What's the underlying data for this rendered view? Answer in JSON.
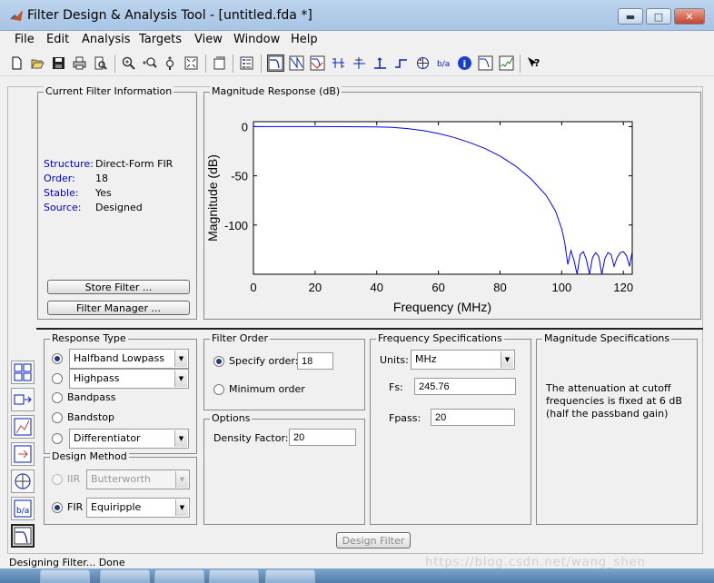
{
  "window": {
    "title": "Filter Design & Analysis Tool -  [untitled.fda *]"
  },
  "menu": [
    "File",
    "Edit",
    "Analysis",
    "Targets",
    "View",
    "Window",
    "Help"
  ],
  "toolbar": {
    "icons": [
      "new-file-icon",
      "open-folder-icon",
      "save-icon",
      "print-icon",
      "print-preview-icon",
      "zoom-in-icon",
      "zoom-x-icon",
      "zoom-y-icon",
      "full-view-icon",
      "new-figure-icon",
      "legend-icon",
      "magnitude-response-icon",
      "phase-response-icon",
      "magnitude-phase-icon",
      "group-delay-icon",
      "phase-delay-icon",
      "impulse-response-icon",
      "step-response-icon",
      "pole-zero-icon",
      "filter-coefficients-icon",
      "filter-info-icon",
      "magnitude-estimate-icon",
      "round-off-noise-icon",
      "whats-this-icon"
    ]
  },
  "current_filter_info": {
    "title": "Current Filter Information",
    "rows": [
      {
        "label": "Structure:",
        "value": "Direct-Form FIR"
      },
      {
        "label": "Order:",
        "value": "18"
      },
      {
        "label": "Stable:",
        "value": "Yes"
      },
      {
        "label": "Source:",
        "value": "Designed"
      }
    ],
    "store_filter_label": "Store Filter ...",
    "filter_manager_label": "Filter Manager ..."
  },
  "magnitude_response": {
    "title": "Magnitude Response (dB)"
  },
  "chart_data": {
    "type": "line",
    "xlabel": "Frequency (MHz)",
    "ylabel": "Magnitude (dB)",
    "xlim": [
      0,
      122.88
    ],
    "ylim": [
      -150,
      5
    ],
    "xticks": [
      "0",
      "20",
      "40",
      "60",
      "80",
      "100",
      "120"
    ],
    "yticks": [
      "0",
      "-50",
      "-100"
    ],
    "grid": false,
    "series": [
      {
        "color": "#0000ff",
        "x": [
          0,
          10,
          20,
          30,
          40,
          45,
          50,
          55,
          60,
          65,
          70,
          75,
          80,
          85,
          90,
          95,
          98,
          100,
          101,
          102,
          103,
          104,
          105,
          106,
          107,
          108,
          109,
          110,
          111,
          112,
          113,
          114,
          115,
          116,
          117,
          118,
          119,
          120,
          121,
          122,
          122.88
        ],
        "y": [
          0,
          0,
          0,
          -0.1,
          -0.3,
          -0.8,
          -2,
          -4,
          -7,
          -11,
          -16,
          -22,
          -30,
          -40,
          -53,
          -70,
          -86,
          -104,
          -118,
          -140,
          -126,
          -136,
          -150,
          -130,
          -127,
          -135,
          -150,
          -133,
          -128,
          -132,
          -150,
          -134,
          -128,
          -130,
          -142,
          -133,
          -128,
          -127,
          -131,
          -142,
          -127
        ]
      }
    ]
  },
  "response_type": {
    "title": "Response Type",
    "options": [
      {
        "label": "Halfband Lowpass",
        "type": "select",
        "checked": true
      },
      {
        "label": "Highpass",
        "type": "select",
        "checked": false
      },
      {
        "label": "Bandpass",
        "type": "radio",
        "checked": false
      },
      {
        "label": "Bandstop",
        "type": "radio",
        "checked": false
      },
      {
        "label": "Differentiator",
        "type": "select",
        "checked": false
      }
    ]
  },
  "design_method": {
    "title": "Design Method",
    "iir_label": "IIR",
    "iir_value": "Butterworth",
    "fir_label": "FIR",
    "fir_value": "Equiripple"
  },
  "filter_order": {
    "title": "Filter Order",
    "specify_label": "Specify order:",
    "specify_value": "18",
    "minimum_label": "Minimum order"
  },
  "options": {
    "title": "Options",
    "density_label": "Density Factor:",
    "density_value": "20"
  },
  "frequency_specs": {
    "title": "Frequency Specifications",
    "units_label": "Units:",
    "units_value": "MHz",
    "fs_label": "Fs:",
    "fs_value": "245.76",
    "fpass_label": "Fpass:",
    "fpass_value": "20"
  },
  "magnitude_specs": {
    "title": "Magnitude Specifications",
    "note": "The attenuation at cutoff frequencies is fixed at 6 dB (half the passband gain)"
  },
  "design_filter_label": "Design Filter",
  "status": {
    "left": "Designing Filter... Done"
  },
  "watermark": "https://blog.csdn.net/wang_shen"
}
